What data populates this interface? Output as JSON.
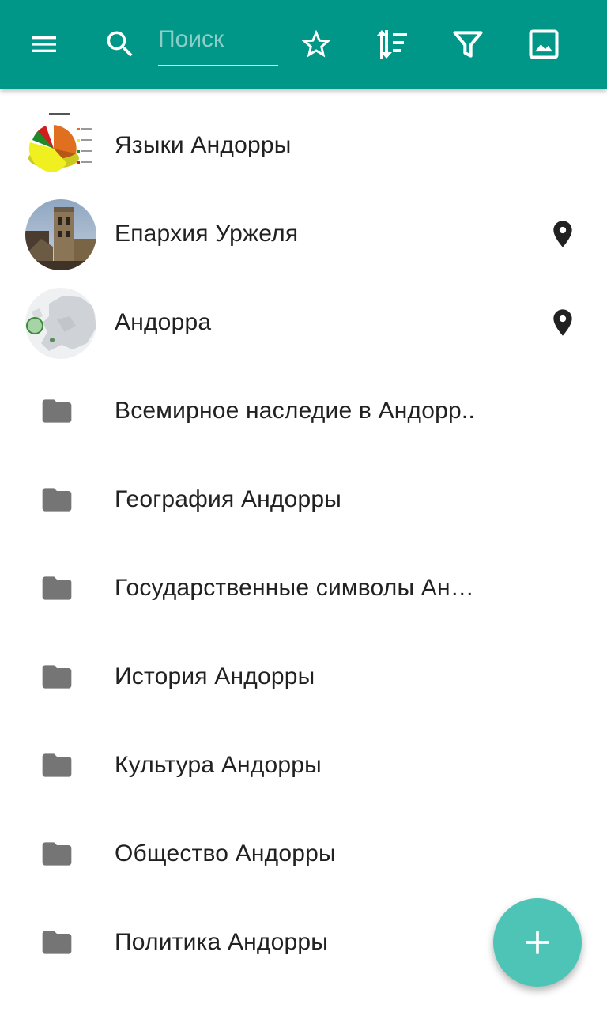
{
  "toolbar": {
    "background_color": "#009688",
    "search_placeholder": "Поиск",
    "search_value": "",
    "menu_icon": "menu-icon",
    "search_icon": "search-icon",
    "favorites_icon": "star-outline-icon",
    "sort_icon": "sort-icon",
    "filter_icon": "filter-icon",
    "image_icon": "image-icon"
  },
  "items": [
    {
      "label": "Языки Андорры",
      "thumb": "pie-chart-thumbnail",
      "has_location": false
    },
    {
      "label": "Епархия Уржеля",
      "thumb": "cathedral-tower-thumbnail",
      "has_location": true
    },
    {
      "label": "Андорра",
      "thumb": "europe-map-thumbnail",
      "has_location": true
    },
    {
      "label": "Всемирное наследие в Андорр..",
      "icon": "folder-icon"
    },
    {
      "label": "География Андорры",
      "icon": "folder-icon"
    },
    {
      "label": "Государственные символы Ан…",
      "icon": "folder-icon"
    },
    {
      "label": "История Андорры",
      "icon": "folder-icon"
    },
    {
      "label": "Культура Андорры",
      "icon": "folder-icon"
    },
    {
      "label": "Общество Андорры",
      "icon": "folder-icon"
    },
    {
      "label": "Политика Андорры",
      "icon": "folder-icon"
    }
  ],
  "fab": {
    "icon": "plus-icon",
    "color": "#4DC4B5"
  }
}
